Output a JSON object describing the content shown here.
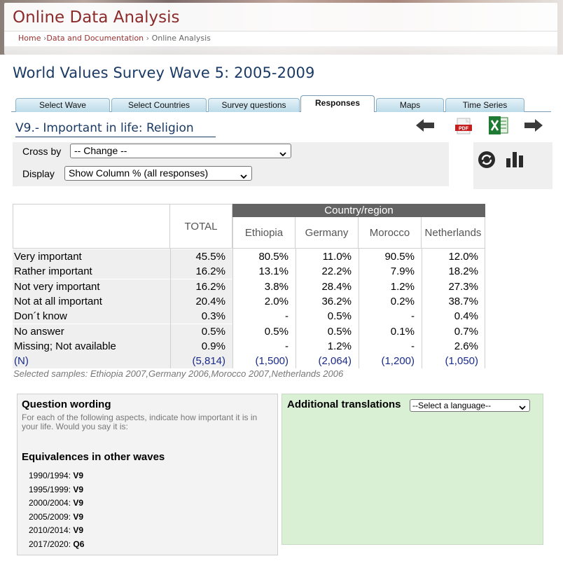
{
  "header": {
    "app_title": "Online Data Analysis",
    "breadcrumb": {
      "home": "Home",
      "sep1": "›",
      "data_docs": "Data and Documentation",
      "sep2": "›",
      "current": "Online Analysis"
    }
  },
  "page_title": "World Values Survey Wave 5: 2005-2009",
  "tabs": [
    {
      "label": "Select Wave",
      "active": false
    },
    {
      "label": "Select Countries",
      "active": false
    },
    {
      "label": "Survey questions",
      "active": false
    },
    {
      "label": "Responses",
      "active": true
    },
    {
      "label": "Maps",
      "active": false
    },
    {
      "label": "Time Series",
      "active": false
    }
  ],
  "variable": {
    "title": "V9.- Important in life: Religion"
  },
  "icons": {
    "prev": "arrow-left-icon",
    "pdf": "pdf-icon",
    "excel": "excel-icon",
    "next": "arrow-right-icon",
    "refresh": "refresh-icon",
    "chart": "bar-chart-icon"
  },
  "options": {
    "cross_by_label": "Cross by",
    "cross_by_value": "-- Change --",
    "display_label": "Display",
    "display_value": "Show Column % (all responses)"
  },
  "table": {
    "total_header": "TOTAL",
    "group_header": "Country/region",
    "countries": [
      "Ethiopia",
      "Germany",
      "Morocco",
      "Netherlands"
    ],
    "rows": [
      {
        "label": "Very important",
        "total": "45.5%",
        "values": [
          "80.5%",
          "11.0%",
          "90.5%",
          "12.0%"
        ]
      },
      {
        "label": "Rather important",
        "total": "16.2%",
        "values": [
          "13.1%",
          "22.2%",
          "7.9%",
          "18.2%"
        ]
      },
      {
        "label": "Not very important",
        "total": "16.2%",
        "values": [
          "3.8%",
          "28.4%",
          "1.2%",
          "27.3%"
        ]
      },
      {
        "label": "Not at all important",
        "total": "20.4%",
        "values": [
          "2.0%",
          "36.2%",
          "0.2%",
          "38.7%"
        ]
      },
      {
        "label": "Don´t know",
        "total": "0.3%",
        "values": [
          "-",
          "0.5%",
          "-",
          "0.4%"
        ]
      },
      {
        "label": "No answer",
        "total": "0.5%",
        "values": [
          "0.5%",
          "0.5%",
          "0.1%",
          "0.7%"
        ]
      },
      {
        "label": "Missing; Not available",
        "total": "0.9%",
        "values": [
          "-",
          "1.2%",
          "-",
          "2.6%"
        ]
      }
    ],
    "n_row": {
      "label": "(N)",
      "total": "(5,814)",
      "values": [
        "(1,500)",
        "(2,064)",
        "(1,200)",
        "(1,050)"
      ]
    },
    "samples_note": "Selected samples: Ethiopia 2007,Germany 2006,Morocco 2007,Netherlands 2006"
  },
  "question_wording": {
    "heading": "Question wording",
    "text": "For each of the following aspects, indicate how important it is in your life. Would you say it is:",
    "equivalences_heading": "Equivalences in other waves",
    "equivalences": [
      {
        "wave": "1990/1994:",
        "code": "V9"
      },
      {
        "wave": "1995/1999:",
        "code": "V9"
      },
      {
        "wave": "2000/2004:",
        "code": "V9"
      },
      {
        "wave": "2005/2009:",
        "code": "V9"
      },
      {
        "wave": "2010/2014:",
        "code": "V9"
      },
      {
        "wave": "2017/2020:",
        "code": "Q6"
      }
    ]
  },
  "translations": {
    "heading": "Additional translations",
    "select_value": "--Select a language--"
  }
}
